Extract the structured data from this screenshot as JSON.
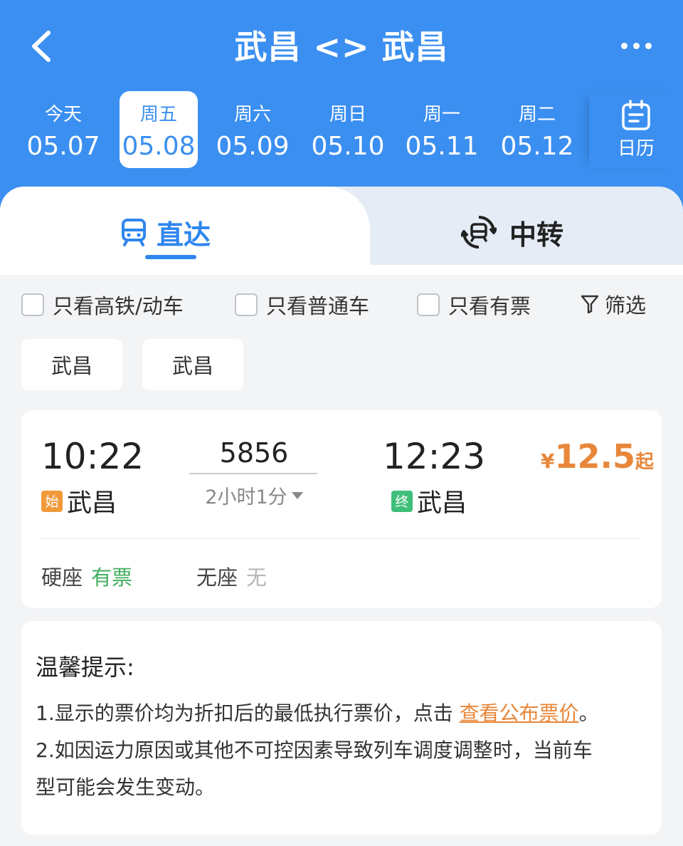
{
  "header": {
    "title": "武昌 <> 武昌",
    "back_icon": "chevron-left-icon",
    "more_icon": "more-dots-icon"
  },
  "dates": [
    {
      "weekday": "今天",
      "date": "05.07",
      "active": false
    },
    {
      "weekday": "周五",
      "date": "05.08",
      "active": true
    },
    {
      "weekday": "周六",
      "date": "05.09",
      "active": false
    },
    {
      "weekday": "周日",
      "date": "05.10",
      "active": false
    },
    {
      "weekday": "周一",
      "date": "05.11",
      "active": false
    },
    {
      "weekday": "周二",
      "date": "05.12",
      "active": false
    }
  ],
  "calendar": {
    "label": "日历",
    "icon": "calendar-icon"
  },
  "tabs": {
    "direct": {
      "label": "直达",
      "icon": "train-icon",
      "active": true
    },
    "transfer": {
      "label": "中转",
      "icon": "transfer-icon",
      "active": false
    }
  },
  "filters": {
    "high_speed": "只看高铁/动车",
    "regular": "只看普通车",
    "available": "只看有票",
    "screen": "筛选"
  },
  "stations": [
    "武昌",
    "武昌"
  ],
  "train": {
    "depart_time": "10:22",
    "arrive_time": "12:23",
    "number": "5856",
    "duration": "2小时1分",
    "from_badge": "始",
    "from_station": "武昌",
    "to_badge": "终",
    "to_station": "武昌",
    "price_currency": "¥",
    "price_value": "12.5",
    "price_suffix": "起",
    "seats": [
      {
        "type": "硬座",
        "status": "有票"
      },
      {
        "type": "无座",
        "status": "无"
      }
    ]
  },
  "notice": {
    "title": "温馨提示:",
    "line1_prefix": "1.显示的票价均为折扣后的最低执行票价，点击 ",
    "line1_link": "查看公布票价",
    "line1_suffix": "。",
    "line2": "2.如因运力原因或其他不可控因素导致列车调度调整时，当前车",
    "line3": "型可能会发生变动。"
  },
  "colors": {
    "header_bg": "#3b8ff1",
    "accent": "#2f86ee",
    "price": "#e8873a",
    "available": "#3fae5d",
    "origin_badge": "#f09a3a",
    "terminal_badge": "#3fbf7a"
  }
}
